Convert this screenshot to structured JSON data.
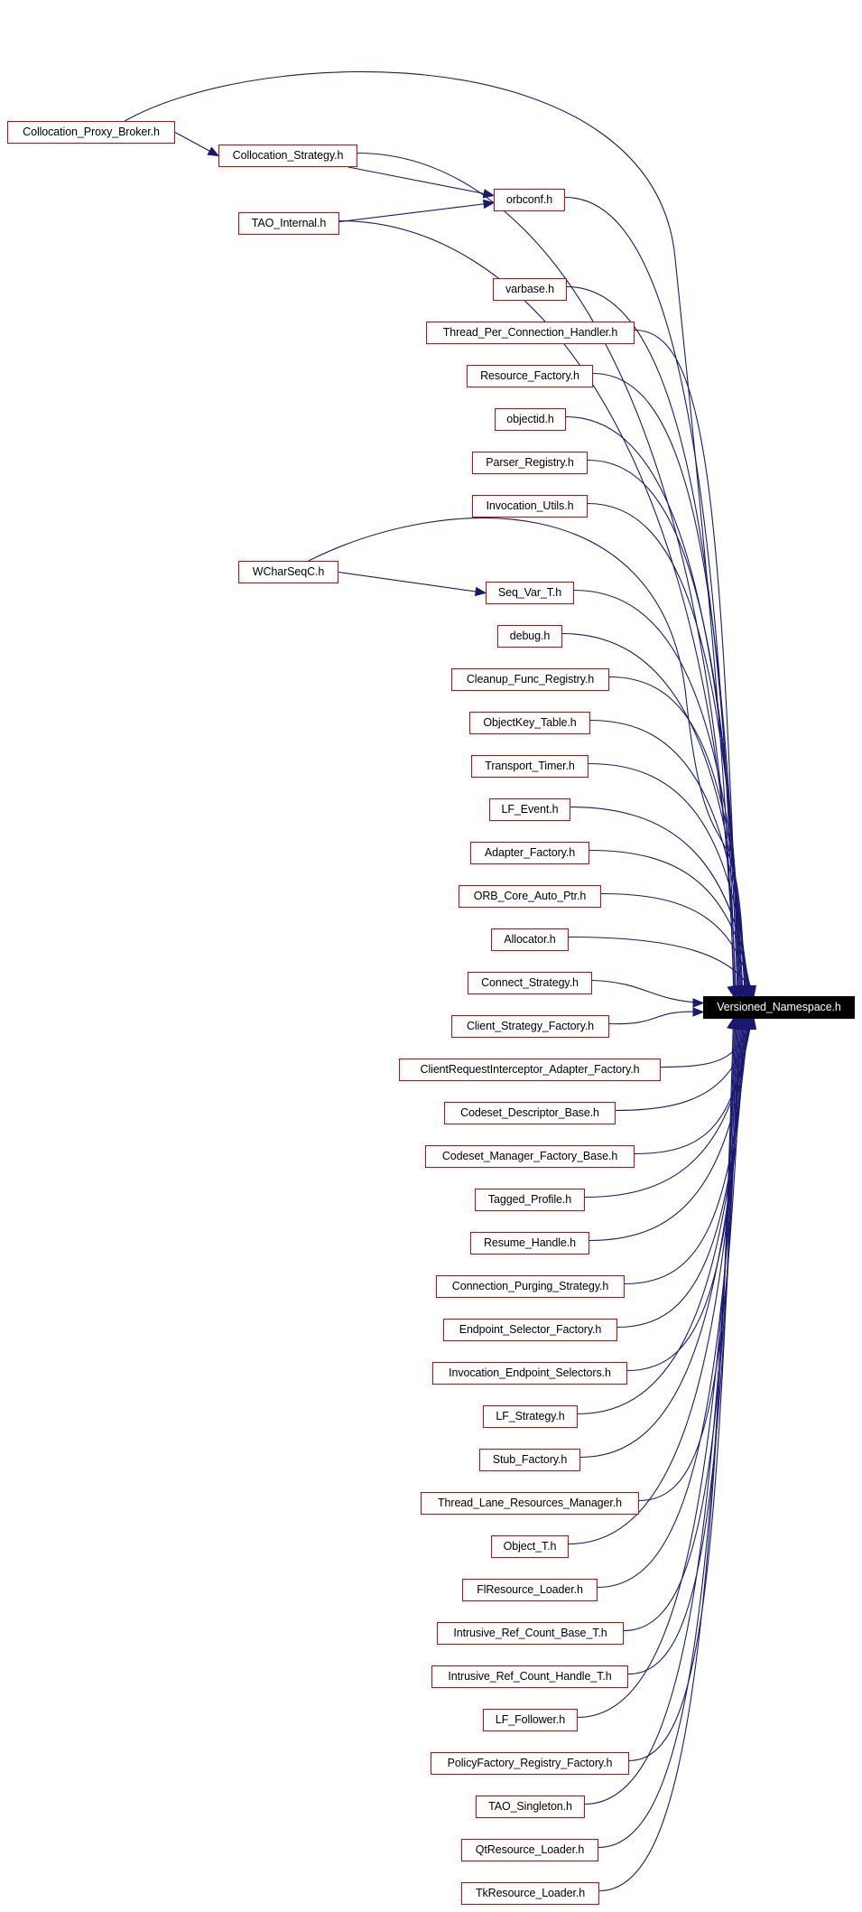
{
  "graph": {
    "type": "include-dependency-graph",
    "target": {
      "id": "versioned-namespace",
      "label": "Versioned_Namespace.h"
    },
    "colors": {
      "edge": "#191970",
      "node_border": "#ff0000",
      "target_fill": "#000000",
      "target_text": "#ffffff"
    },
    "nodes": [
      {
        "id": "collocation-proxy-broker",
        "label": "Collocation_Proxy_Broker.h"
      },
      {
        "id": "collocation-strategy",
        "label": "Collocation_Strategy.h"
      },
      {
        "id": "orbconf",
        "label": "orbconf.h"
      },
      {
        "id": "tao-internal",
        "label": "TAO_Internal.h"
      },
      {
        "id": "varbase",
        "label": "varbase.h"
      },
      {
        "id": "thread-per-connection-handler",
        "label": "Thread_Per_Connection_Handler.h"
      },
      {
        "id": "resource-factory",
        "label": "Resource_Factory.h"
      },
      {
        "id": "objectid",
        "label": "objectid.h"
      },
      {
        "id": "parser-registry",
        "label": "Parser_Registry.h"
      },
      {
        "id": "invocation-utils",
        "label": "Invocation_Utils.h"
      },
      {
        "id": "wcharseqc",
        "label": "WCharSeqC.h"
      },
      {
        "id": "seq-var-t",
        "label": "Seq_Var_T.h"
      },
      {
        "id": "debug",
        "label": "debug.h"
      },
      {
        "id": "cleanup-func-registry",
        "label": "Cleanup_Func_Registry.h"
      },
      {
        "id": "objectkey-table",
        "label": "ObjectKey_Table.h"
      },
      {
        "id": "transport-timer",
        "label": "Transport_Timer.h"
      },
      {
        "id": "lf-event",
        "label": "LF_Event.h"
      },
      {
        "id": "adapter-factory",
        "label": "Adapter_Factory.h"
      },
      {
        "id": "orb-core-auto-ptr",
        "label": "ORB_Core_Auto_Ptr.h"
      },
      {
        "id": "allocator",
        "label": "Allocator.h"
      },
      {
        "id": "connect-strategy",
        "label": "Connect_Strategy.h"
      },
      {
        "id": "client-strategy-factory",
        "label": "Client_Strategy_Factory.h"
      },
      {
        "id": "clientrequestinterceptor-adapter-factory",
        "label": "ClientRequestInterceptor_Adapter_Factory.h"
      },
      {
        "id": "codeset-descriptor-base",
        "label": "Codeset_Descriptor_Base.h"
      },
      {
        "id": "codeset-manager-factory-base",
        "label": "Codeset_Manager_Factory_Base.h"
      },
      {
        "id": "tagged-profile",
        "label": "Tagged_Profile.h"
      },
      {
        "id": "resume-handle",
        "label": "Resume_Handle.h"
      },
      {
        "id": "connection-purging-strategy",
        "label": "Connection_Purging_Strategy.h"
      },
      {
        "id": "endpoint-selector-factory",
        "label": "Endpoint_Selector_Factory.h"
      },
      {
        "id": "invocation-endpoint-selectors",
        "label": "Invocation_Endpoint_Selectors.h"
      },
      {
        "id": "lf-strategy",
        "label": "LF_Strategy.h"
      },
      {
        "id": "stub-factory",
        "label": "Stub_Factory.h"
      },
      {
        "id": "thread-lane-resources-manager",
        "label": "Thread_Lane_Resources_Manager.h"
      },
      {
        "id": "object-t",
        "label": "Object_T.h"
      },
      {
        "id": "flresource-loader",
        "label": "FlResource_Loader.h"
      },
      {
        "id": "intrusive-ref-count-base-t",
        "label": "Intrusive_Ref_Count_Base_T.h"
      },
      {
        "id": "intrusive-ref-count-handle-t",
        "label": "Intrusive_Ref_Count_Handle_T.h"
      },
      {
        "id": "lf-follower",
        "label": "LF_Follower.h"
      },
      {
        "id": "policyfactory-registry-factory",
        "label": "PolicyFactory_Registry_Factory.h"
      },
      {
        "id": "tao-singleton",
        "label": "TAO_Singleton.h"
      },
      {
        "id": "qtresource-loader",
        "label": "QtResource_Loader.h"
      },
      {
        "id": "tkresource-loader",
        "label": "TkResource_Loader.h"
      }
    ],
    "edges": [
      [
        "collocation-proxy-broker",
        "collocation-strategy"
      ],
      [
        "collocation-proxy-broker",
        "versioned-namespace"
      ],
      [
        "collocation-strategy",
        "orbconf"
      ],
      [
        "collocation-strategy",
        "versioned-namespace"
      ],
      [
        "tao-internal",
        "orbconf"
      ],
      [
        "tao-internal",
        "versioned-namespace"
      ],
      [
        "orbconf",
        "versioned-namespace"
      ],
      [
        "varbase",
        "versioned-namespace"
      ],
      [
        "thread-per-connection-handler",
        "versioned-namespace"
      ],
      [
        "resource-factory",
        "versioned-namespace"
      ],
      [
        "objectid",
        "versioned-namespace"
      ],
      [
        "parser-registry",
        "versioned-namespace"
      ],
      [
        "invocation-utils",
        "versioned-namespace"
      ],
      [
        "wcharseqc",
        "seq-var-t"
      ],
      [
        "wcharseqc",
        "versioned-namespace"
      ],
      [
        "seq-var-t",
        "versioned-namespace"
      ],
      [
        "debug",
        "versioned-namespace"
      ],
      [
        "cleanup-func-registry",
        "versioned-namespace"
      ],
      [
        "objectkey-table",
        "versioned-namespace"
      ],
      [
        "transport-timer",
        "versioned-namespace"
      ],
      [
        "lf-event",
        "versioned-namespace"
      ],
      [
        "adapter-factory",
        "versioned-namespace"
      ],
      [
        "orb-core-auto-ptr",
        "versioned-namespace"
      ],
      [
        "allocator",
        "versioned-namespace"
      ],
      [
        "connect-strategy",
        "versioned-namespace"
      ],
      [
        "client-strategy-factory",
        "versioned-namespace"
      ],
      [
        "clientrequestinterceptor-adapter-factory",
        "versioned-namespace"
      ],
      [
        "codeset-descriptor-base",
        "versioned-namespace"
      ],
      [
        "codeset-manager-factory-base",
        "versioned-namespace"
      ],
      [
        "tagged-profile",
        "versioned-namespace"
      ],
      [
        "resume-handle",
        "versioned-namespace"
      ],
      [
        "connection-purging-strategy",
        "versioned-namespace"
      ],
      [
        "endpoint-selector-factory",
        "versioned-namespace"
      ],
      [
        "invocation-endpoint-selectors",
        "versioned-namespace"
      ],
      [
        "lf-strategy",
        "versioned-namespace"
      ],
      [
        "stub-factory",
        "versioned-namespace"
      ],
      [
        "thread-lane-resources-manager",
        "versioned-namespace"
      ],
      [
        "object-t",
        "versioned-namespace"
      ],
      [
        "flresource-loader",
        "versioned-namespace"
      ],
      [
        "intrusive-ref-count-base-t",
        "versioned-namespace"
      ],
      [
        "intrusive-ref-count-handle-t",
        "versioned-namespace"
      ],
      [
        "lf-follower",
        "versioned-namespace"
      ],
      [
        "policyfactory-registry-factory",
        "versioned-namespace"
      ],
      [
        "tao-singleton",
        "versioned-namespace"
      ],
      [
        "qtresource-loader",
        "versioned-namespace"
      ],
      [
        "tkresource-loader",
        "versioned-namespace"
      ]
    ]
  }
}
